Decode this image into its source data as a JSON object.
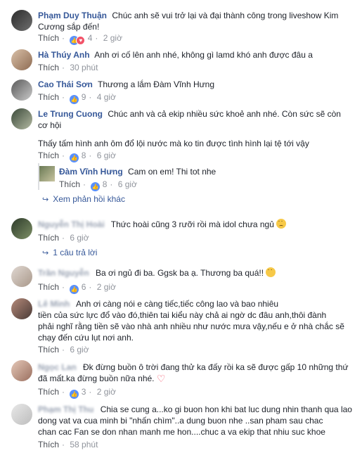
{
  "ui": {
    "like": "Thích",
    "reply_link": "Xem phản hồi khác",
    "one_reply": "1 câu trả lời"
  },
  "comments": [
    {
      "name": "Phạm Duy Thuận",
      "line1": "Chúc anh sẽ vui trở lại và đại thành công trong liveshow Kim",
      "line2": "Cương sắp đến!",
      "count": "4",
      "time": "2 giờ"
    },
    {
      "name": "Hà Thúy Anh",
      "line1": "Anh ơi cố lên anh nhé, không gì lamd khó anh được đâu a",
      "time": "30 phút"
    },
    {
      "name": "Cao Thái Sơn",
      "text": "Thương a lắm",
      "mention": "Đàm Vĩnh Hưng",
      "count": "9",
      "time": "4 giờ"
    },
    {
      "name": "Le Trung Cuong",
      "line1": "Chúc anh và cả ekip nhiều sức khoẻ anh nhé. Còn sức sẽ còn",
      "line2": "cơ hội",
      "line3": "Thấy tấm hình anh ôm đổ lội nước mà ko tin được tình hình lại tệ tới vậy",
      "count": "8",
      "time": "6 giờ",
      "reply": {
        "name": "Đàm Vĩnh Hưng",
        "text": "Cam on em! Thi tot nhe",
        "count": "8",
        "time": "6 giờ"
      }
    },
    {
      "name": "Nguyễn Thị Hoài",
      "line1": "Thức hoài cũng 3 rưỡi rồi mà idol chưa ngủ",
      "time": "6 giờ"
    },
    {
      "name": "Trần Nguyễn",
      "line1": "Ba ơi ngủ đi ba. Ggsk ba ạ. Thương ba quá!!",
      "count": "6",
      "time": "2 giờ"
    },
    {
      "name": "Lê Minh",
      "line1": "Anh ơi càng nói e càng tiếc,tiếc công lao và bao nhiêu",
      "line2": "tiền của sức lực đổ vào đó,thiên tai kiểu này chả ai ngờ dc đâu anh,thôi đành",
      "line3": "phải nghĩ rằng tiền sẽ vào nhà anh nhiều như nước mưa vậy,nếu e ở nhà chắc sẽ",
      "line4": "chạy đến cứu lụt nơi anh.",
      "time": "6 giờ"
    },
    {
      "name": "Ngọc Lan",
      "line1": "Đk đừng buồn ô trời đang thử ka đấy rồi ka sẽ được gấp 10 những thứ",
      "line2": "đã mất.ka đừng buồn nữa nhé.",
      "count": "3",
      "time": "2 giờ"
    },
    {
      "name": "Phạm Thị Thu",
      "line1": "Chia se cung a...ko gi buon hon khi bat luc dung nhin thanh qua lao",
      "line2": "dong vat va cua minh bi \"nhấn chìm\"..a dung buon nhe ..san pham sau chac",
      "line3": "chan cac Fan se don nhan manh me hon....chuc a va ekip that nhiu suc khoe",
      "time": "58 phút"
    }
  ],
  "colors": {
    "link": "#365899",
    "meta": "#90949c",
    "like_blue": "#5890ff",
    "love_red": "#f25268"
  }
}
